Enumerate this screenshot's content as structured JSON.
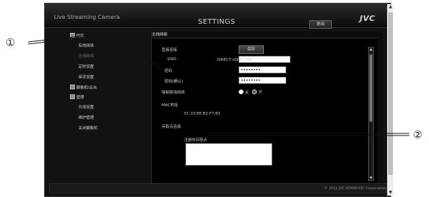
{
  "callouts": {
    "one": "①",
    "two": "②"
  },
  "header": {
    "app_title": "Live Streaming Camera",
    "page_title": "SETTINGS",
    "logout_label": "退出",
    "logo": "JVC"
  },
  "sidebar": {
    "items": [
      {
        "label": "网络"
      },
      {
        "label": "有线网络"
      },
      {
        "label": "无线网络"
      },
      {
        "label": "定时设置"
      },
      {
        "label": "串流设置"
      },
      {
        "label": "摄像机/云台"
      },
      {
        "label": "管理"
      },
      {
        "label": "共用设置"
      },
      {
        "label": "维护管理"
      },
      {
        "label": "关闭摄像机"
      }
    ]
  },
  "panel": {
    "title": "无线网络",
    "direct_connect_label": "直接连接",
    "save_label": "保存",
    "ssid_label": "SSID",
    "ssid_value": "DIRECT-x0JVCCAM",
    "password_label": "密码",
    "password_value": "••••••••",
    "password_confirm_label": "密码(确认)",
    "password_confirm_value": "••••••••",
    "force_disable_label": "强制禁用网络",
    "radio_on_label": "关",
    "radio_off_label": "开",
    "mac_label": "MAC地址",
    "mac_value": "5C:33:8E:B2:F7:B3",
    "access_point_label": "存取点连接",
    "registered_ap_label": "注册的存取点"
  },
  "footer": {
    "copyright": "© 2012 JVC KENWOOD Corporation"
  },
  "scrollbar": {
    "up": "▲",
    "down": "▼"
  }
}
